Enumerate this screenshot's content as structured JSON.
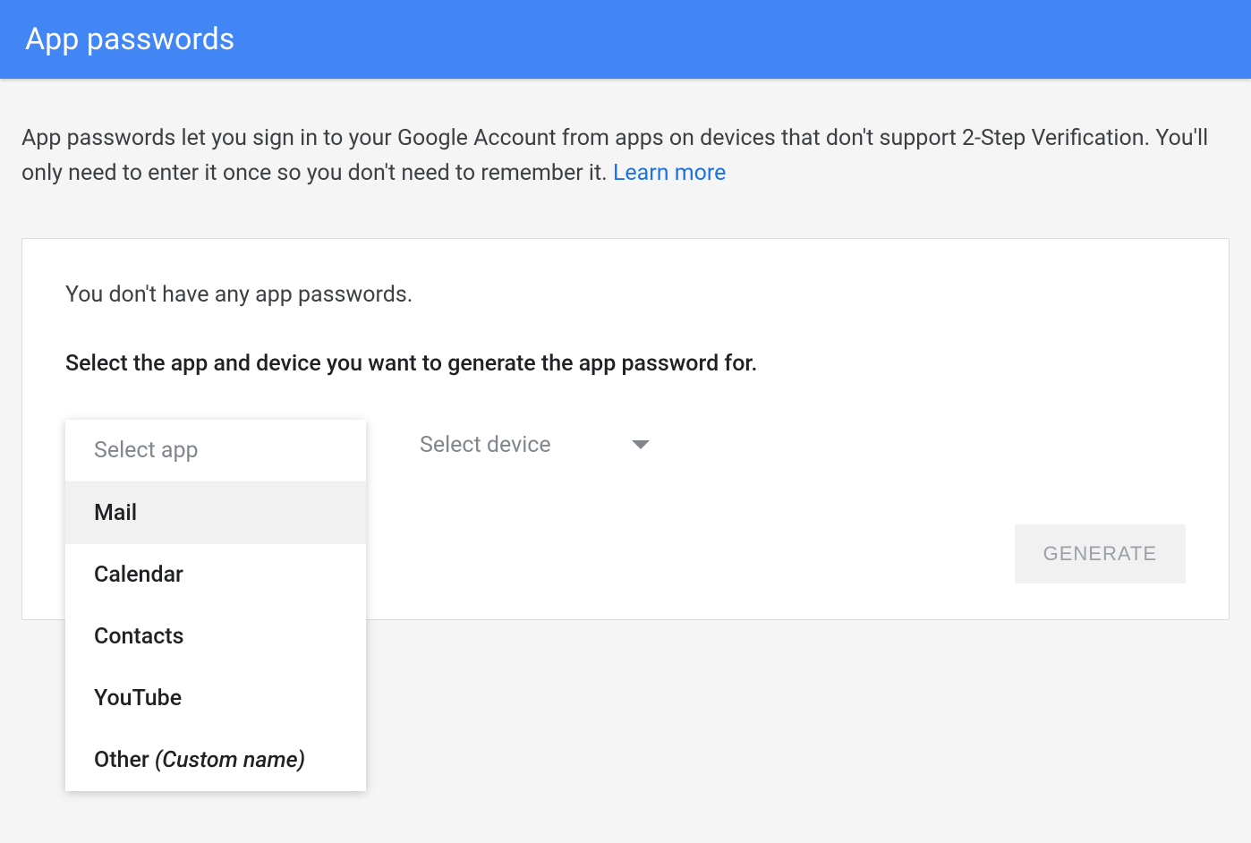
{
  "header": {
    "title": "App passwords"
  },
  "description": {
    "text": "App passwords let you sign in to your Google Account from apps on devices that don't support 2-Step Verification. You'll only need to enter it once so you don't need to remember it. ",
    "learn_more": "Learn more"
  },
  "card": {
    "status": "You don't have any app passwords.",
    "prompt": "Select the app and device you want to generate the app password for.",
    "select_app_label": "Select app",
    "select_device_label": "Select device",
    "dropdown": {
      "header": "Select app",
      "options": [
        {
          "label": "Mail",
          "hovered": true
        },
        {
          "label": "Calendar",
          "hovered": false
        },
        {
          "label": "Contacts",
          "hovered": false
        },
        {
          "label": "YouTube",
          "hovered": false
        }
      ],
      "other_prefix": "Other ",
      "other_custom": "(Custom name)"
    },
    "generate_label": "GENERATE"
  }
}
